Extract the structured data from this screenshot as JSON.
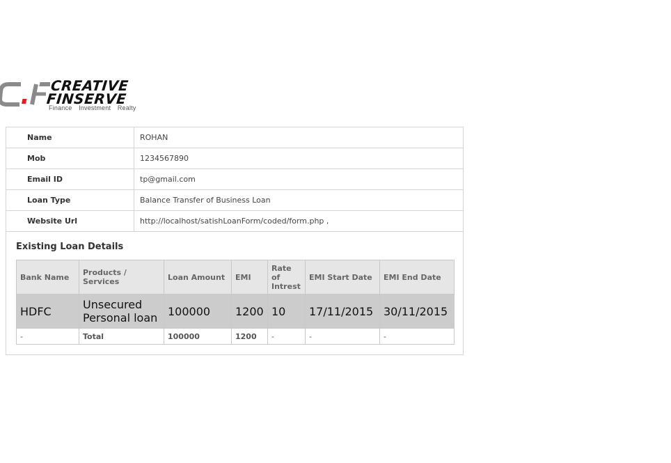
{
  "logo": {
    "mark": "C.F",
    "brand_line1": "CREATIVE",
    "brand_line2": "FINSERVE",
    "tagline": "Finance Investment Realty",
    "colors": {
      "gray": "#8a8a8a",
      "red": "#e0201b",
      "dark": "#111111"
    }
  },
  "info": {
    "rows": [
      {
        "label": "Name",
        "value": "ROHAN"
      },
      {
        "label": "Mob",
        "value": "1234567890"
      },
      {
        "label": "Email ID",
        "value": "tp@gmail.com"
      },
      {
        "label": "Loan Type",
        "value": "Balance Transfer of Business Loan"
      },
      {
        "label": "Website Url",
        "value": "http://localhost/satishLoanForm/coded/form.php ,"
      }
    ]
  },
  "existing": {
    "title": "Existing Loan Details",
    "headers": [
      "Bank Name",
      "Products / Services",
      "Loan Amount",
      "EMI",
      "Rate of Intrest",
      "EMI Start Date",
      "EMI End Date"
    ],
    "row": [
      "HDFC",
      "Unsecured Personal loan",
      "100000",
      "1200",
      "10",
      "17/11/2015",
      "30/11/2015"
    ],
    "total": [
      "-",
      "Total",
      "100000",
      "1200",
      "-",
      "-",
      "-"
    ]
  }
}
